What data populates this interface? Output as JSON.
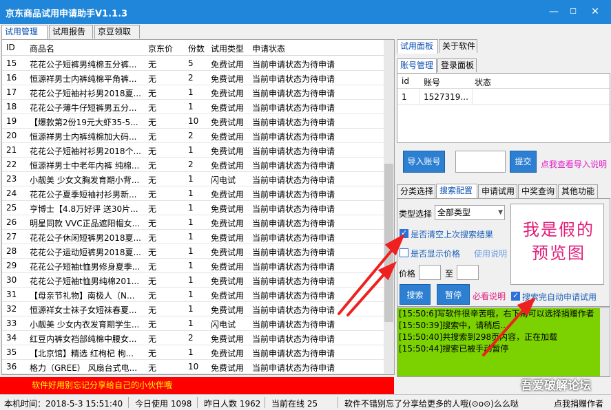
{
  "window": {
    "title": "京东商品试用申请助手V1.1.3",
    "minimize": "—",
    "maximize": "☐",
    "close": "✕"
  },
  "main_tabs": [
    "试用管理",
    "试用报告",
    "京豆领取"
  ],
  "grid": {
    "headers": [
      "ID",
      "商品名",
      "京东价",
      "份数",
      "试用类型",
      "申请状态"
    ],
    "rows": [
      [
        "15",
        "花花公子短裤男纯棉五分裤...",
        "无",
        "5",
        "免费试用",
        "当前申请状态为待申请"
      ],
      [
        "16",
        "恒源祥男士内裤纯棉平角裤...",
        "无",
        "2",
        "免费试用",
        "当前申请状态为待申请"
      ],
      [
        "17",
        "花花公子短袖衬衫男2018夏...",
        "无",
        "1",
        "免费试用",
        "当前申请状态为待申请"
      ],
      [
        "18",
        "花花公子薄牛仔短裤男五分...",
        "无",
        "1",
        "免费试用",
        "当前申请状态为待申请"
      ],
      [
        "19",
        "【爆款第2份19元大虾35-5...",
        "无",
        "10",
        "免费试用",
        "当前申请状态为待申请"
      ],
      [
        "20",
        "恒源祥男士内裤纯棉加大码...",
        "无",
        "2",
        "免费试用",
        "当前申请状态为待申请"
      ],
      [
        "21",
        "花花公子短袖衬衫男2018个...",
        "无",
        "1",
        "免费试用",
        "当前申请状态为待申请"
      ],
      [
        "22",
        "恒源祥男士中老年内裤 纯棉...",
        "无",
        "2",
        "免费试用",
        "当前申请状态为待申请"
      ],
      [
        "23",
        "小靓美 少女文胸发育期小背...",
        "无",
        "1",
        "闪电试",
        "当前申请状态为待申请"
      ],
      [
        "24",
        "花花公子夏季短袖衬衫男新...",
        "无",
        "1",
        "免费试用",
        "当前申请状态为待申请"
      ],
      [
        "25",
        "亨博士【4.8万好评 送30片...",
        "无",
        "1",
        "免费试用",
        "当前申请状态为待申请"
      ],
      [
        "26",
        "明星同款 VVC正品遮阳帽女...",
        "无",
        "1",
        "免费试用",
        "当前申请状态为待申请"
      ],
      [
        "27",
        "花花公子休闲短裤男2018夏...",
        "无",
        "1",
        "免费试用",
        "当前申请状态为待申请"
      ],
      [
        "28",
        "花花公子运动短裤男2018夏...",
        "无",
        "1",
        "免费试用",
        "当前申请状态为待申请"
      ],
      [
        "29",
        "花花公子短袖t恤男修身夏季...",
        "无",
        "1",
        "免费试用",
        "当前申请状态为待申请"
      ],
      [
        "30",
        "花花公子短袖t恤男纯棉201...",
        "无",
        "1",
        "免费试用",
        "当前申请状态为待申请"
      ],
      [
        "31",
        "【母亲节礼物】南极人（N...",
        "无",
        "1",
        "免费试用",
        "当前申请状态为待申请"
      ],
      [
        "32",
        "恒源祥女士袜子女短袜春夏...",
        "无",
        "1",
        "免费试用",
        "当前申请状态为待申请"
      ],
      [
        "33",
        "小靓美 少女内衣发育期学生...",
        "无",
        "1",
        "闪电试",
        "当前申请状态为待申请"
      ],
      [
        "34",
        "红豆内裤女裆部纯棉中腰女...",
        "无",
        "2",
        "免费试用",
        "当前申请状态为待申请"
      ],
      [
        "35",
        "【北京馆】精选 红枸杞 枸...",
        "无",
        "1",
        "免费试用",
        "当前申请状态为待申请"
      ],
      [
        "36",
        "格力（GREE） 风扇台式电...",
        "无",
        "10",
        "免费试用",
        "当前申请状态为待申请"
      ]
    ]
  },
  "red_banner": "软件好用别忘记分享给自己的小伙伴哦",
  "status_bar": {
    "local_time": "本机时间：2018-5-3 15:51:40",
    "today_use": "今日使用 1098",
    "yesterday": "昨日人数 1962",
    "online": "当前在线 25",
    "share_msg": "软件不错别忘了分享给更多的人哦(⊙o⊙)么么哒",
    "donate": "点我捐赠作者"
  },
  "right_tabs": [
    "试用面板",
    "关于软件"
  ],
  "account_tabs": [
    "账号管理",
    "登录面板"
  ],
  "accounts": {
    "headers": [
      "id",
      "账号",
      "状态"
    ],
    "rows": [
      [
        "1",
        "1527319...",
        ""
      ]
    ]
  },
  "import": {
    "button": "导入账号",
    "input_value": "",
    "submit": "提交",
    "help_link": "点我查看导入说明"
  },
  "func_tabs": [
    "分类选择",
    "搜索配置",
    "申请试用",
    "中奖查询",
    "其他功能"
  ],
  "search": {
    "type_label": "类型选择",
    "type_value": "全部类型",
    "clear_last": {
      "label": "是否清空上次搜索结果",
      "checked": true
    },
    "show_price": {
      "label": "是否显示价格",
      "checked": false
    },
    "usage_link": "使用说明",
    "price_label": "价格",
    "price_min": "",
    "to_label": "至",
    "price_max": "",
    "search_btn": "搜索",
    "pause_btn": "暂停",
    "must_read": "必看说明",
    "auto_apply": {
      "label": "搜索完自动申请试用",
      "checked": true
    }
  },
  "preview_text": "我是假的预览图",
  "log_lines": [
    "[15:50:6]写软件很辛苦哦，右下角可以选择捐赠作者",
    "[15:50:39]搜索中，请稍后...",
    "[15:50:40]共搜索到298页内容，正在加载",
    "[15:50:44]搜索已被手动暂停"
  ],
  "watermark": "吾爱破解论坛",
  "colors": {
    "titlebar": "#1f86d9",
    "accent_blue": "#2d7fd1",
    "red_banner": "#ff0000",
    "log_bg": "#7cd200",
    "annotation_red": "#ee2020"
  }
}
